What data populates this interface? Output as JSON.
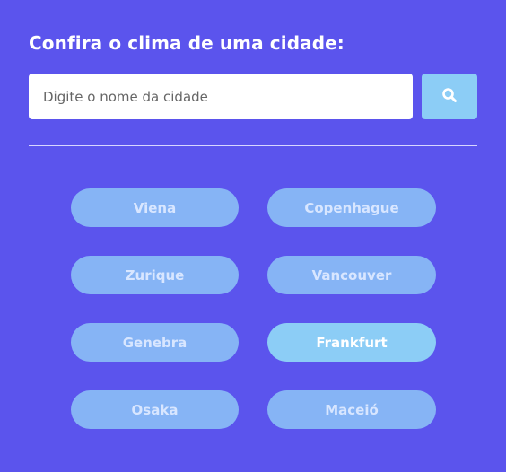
{
  "header": {
    "title": "Confira o clima de uma cidade:"
  },
  "search": {
    "placeholder": "Digite o nome da cidade",
    "value": "",
    "button_icon": "search-icon"
  },
  "cities": [
    {
      "label": "Viena",
      "active": false
    },
    {
      "label": "Copenhague",
      "active": false
    },
    {
      "label": "Zurique",
      "active": false
    },
    {
      "label": "Vancouver",
      "active": false
    },
    {
      "label": "Genebra",
      "active": false
    },
    {
      "label": "Frankfurt",
      "active": true
    },
    {
      "label": "Osaka",
      "active": false
    },
    {
      "label": "Maceió",
      "active": false
    }
  ],
  "colors": {
    "background": "#5b54ed",
    "city_button": "#86b4f5",
    "city_button_active": "#8ccdf6",
    "search_button": "#8ccdf6"
  }
}
